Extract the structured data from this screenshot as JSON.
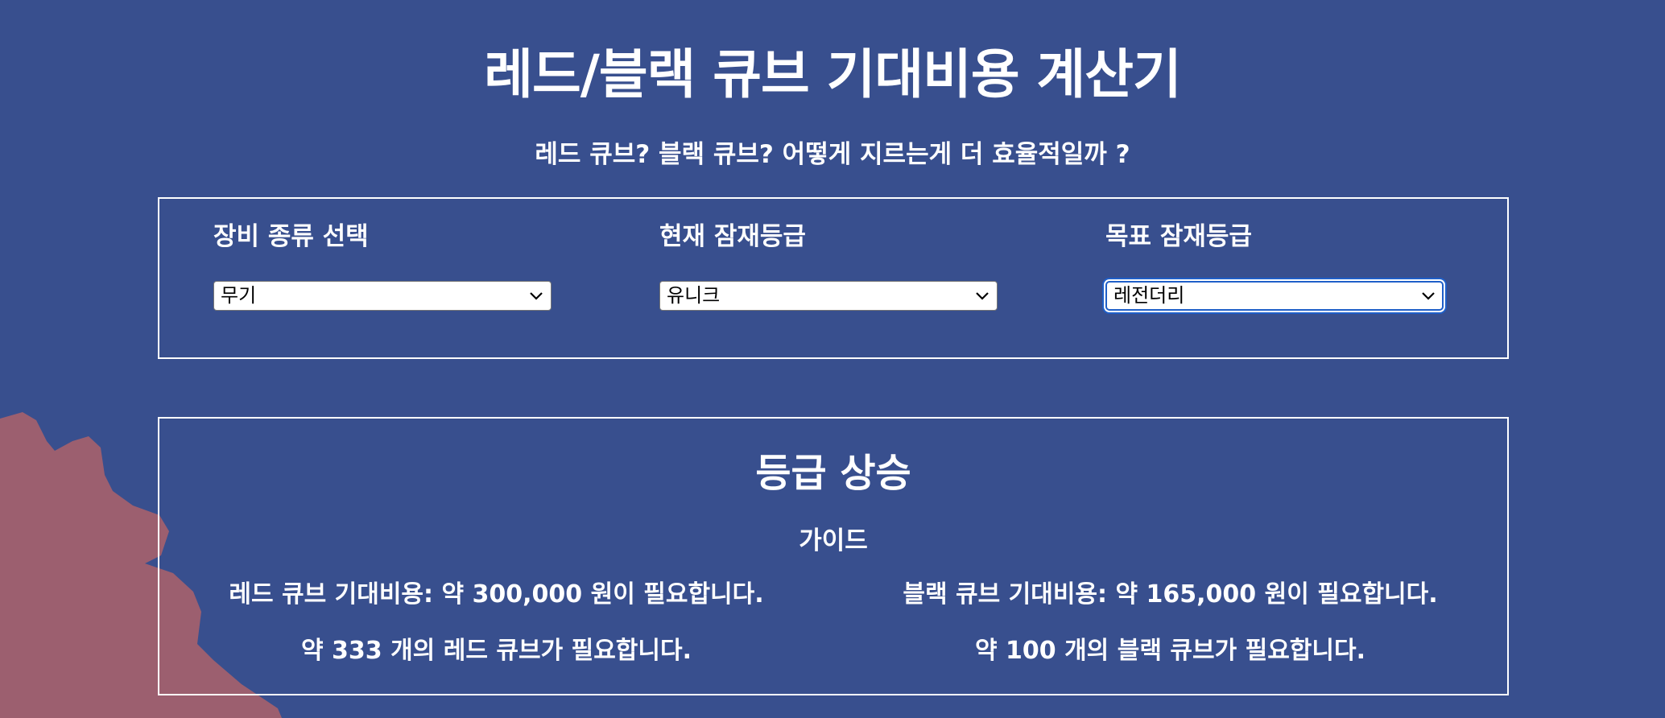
{
  "header": {
    "title": "레드/블랙 큐브 기대비용 계산기",
    "subtitle": "레드 큐브? 블랙 큐브? 어떻게 지르는게 더 효율적일까 ?"
  },
  "selectors": {
    "equipment": {
      "label": "장비 종류 선택",
      "value": "무기"
    },
    "current_grade": {
      "label": "현재 잠재등급",
      "value": "유니크"
    },
    "target_grade": {
      "label": "목표 잠재등급",
      "value": "레전더리"
    }
  },
  "result": {
    "title": "등급 상승",
    "guide_label": "가이드",
    "red": {
      "cost_text": "레드 큐브 기대비용: 약 300,000 원이 필요합니다.",
      "count_text": "약 333 개의 레드 큐브가 필요합니다."
    },
    "black": {
      "cost_text": "블랙 큐브 기대비용: 약 165,000 원이 필요합니다.",
      "count_text": "약 100 개의 블랙 큐브가 필요합니다."
    }
  },
  "icons": {
    "select_arrow": "chevron-down-icon"
  },
  "colors": {
    "background": "#384f8e",
    "text": "#ffffff",
    "focus_ring": "#1f5fc8",
    "decoration": "#9c5f6f"
  }
}
